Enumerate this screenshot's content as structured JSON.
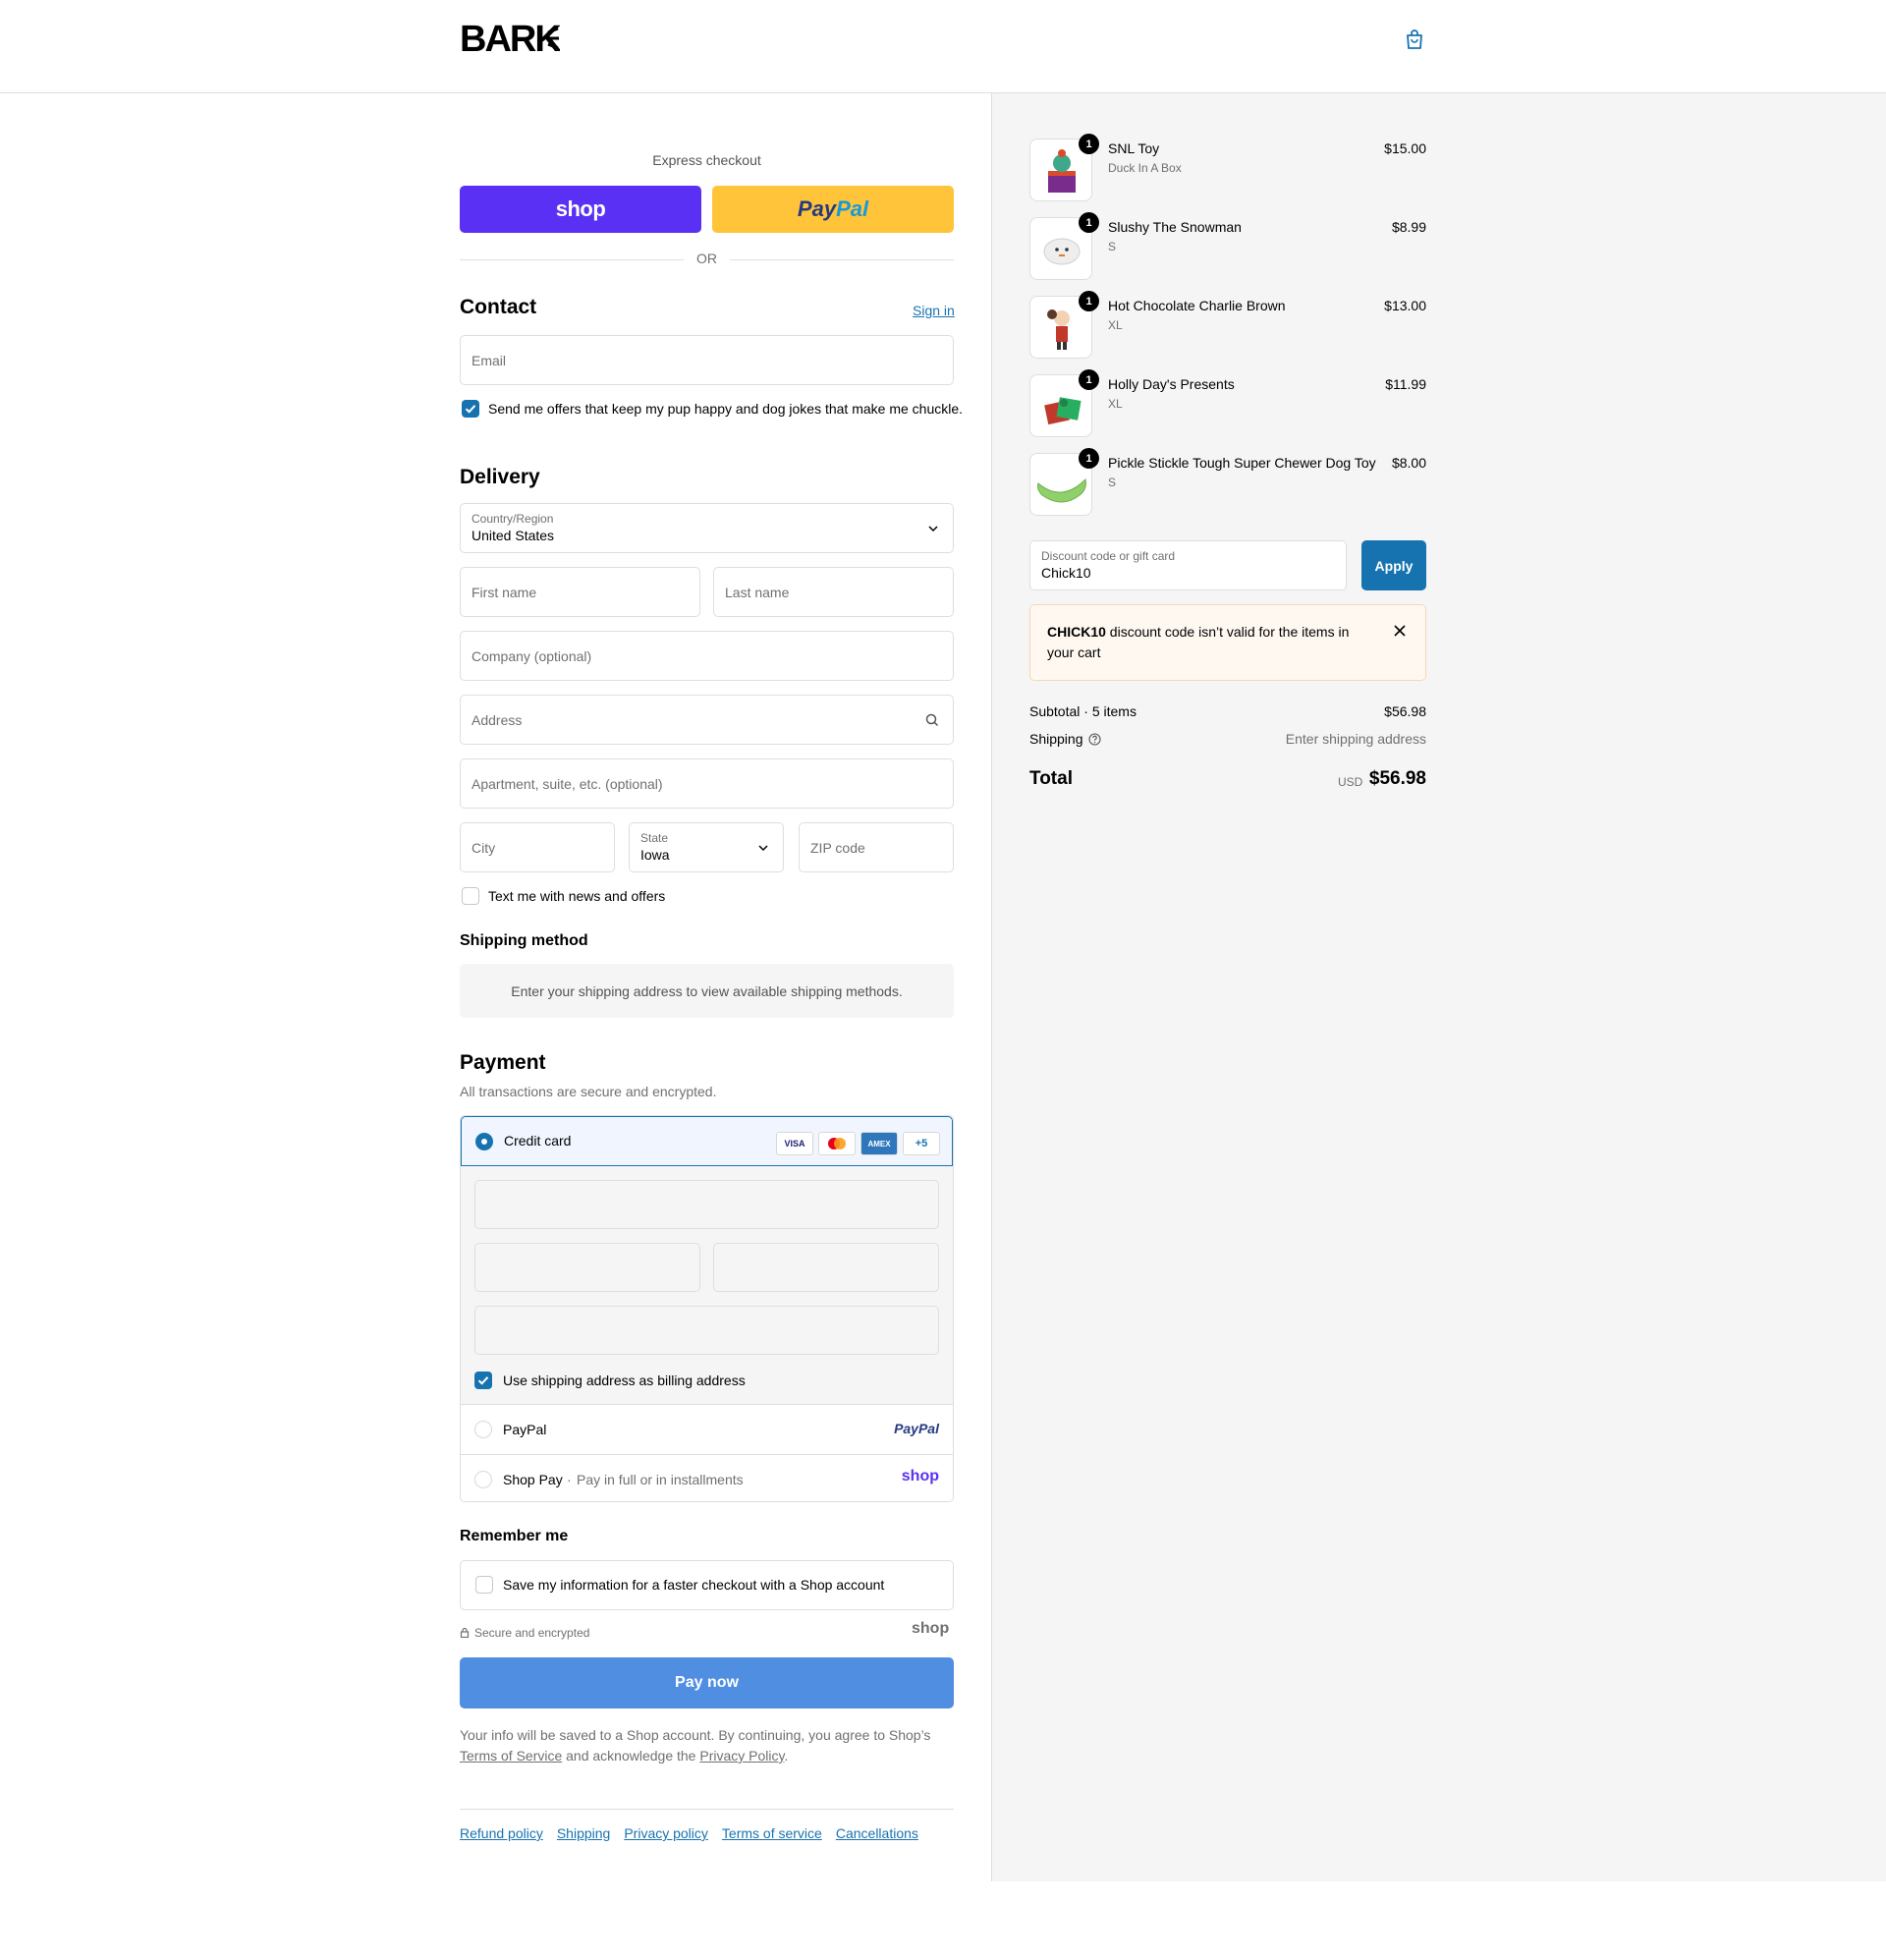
{
  "header": {
    "brand": "BARK",
    "cart_icon": "shopping-bag-icon"
  },
  "express": {
    "label": "Express checkout",
    "shop_label": "shop",
    "paypal_label_1": "Pay",
    "paypal_label_2": "Pal",
    "or": "OR"
  },
  "contact": {
    "title": "Contact",
    "sign_in": "Sign in",
    "email_placeholder": "Email",
    "offers_label": "Send me offers that keep my pup happy and dog jokes that make me chuckle.",
    "offers_checked": true
  },
  "delivery": {
    "title": "Delivery",
    "country_label": "Country/Region",
    "country_value": "United States",
    "first_name": "First name",
    "last_name": "Last name",
    "company": "Company (optional)",
    "address": "Address",
    "apartment": "Apartment, suite, etc. (optional)",
    "city": "City",
    "state_label": "State",
    "state_value": "Iowa",
    "zip": "ZIP code",
    "text_label": "Text me with news and offers",
    "text_checked": false
  },
  "shipping_method": {
    "title": "Shipping method",
    "message": "Enter your shipping address to view available shipping methods."
  },
  "payment": {
    "title": "Payment",
    "subtitle": "All transactions are secure and encrypted.",
    "credit_card": "Credit card",
    "cards": [
      "VISA",
      "MC",
      "AMEX",
      "+5"
    ],
    "billing_label": "Use shipping address as billing address",
    "paypal": "PayPal",
    "paypal_logo": "PayPal",
    "shop_pay": "Shop Pay",
    "shop_pay_sep": "·",
    "shop_pay_note": "Pay in full or in installments",
    "shop_logo": "shop"
  },
  "remember": {
    "title": "Remember me",
    "save_label": "Save my information for a faster checkout with a Shop account",
    "secure": "Secure and encrypted",
    "shop_logo": "shop"
  },
  "pay_now": "Pay now",
  "legal": {
    "line1": "Your info will be saved to a Shop account. By continuing, you agree to Shop’s",
    "tos": "Terms of Service",
    "and": " and acknowledge the ",
    "privacy": "Privacy Policy",
    "dot": "."
  },
  "footer_links": [
    "Refund policy",
    "Shipping",
    "Privacy policy",
    "Terms of service",
    "Cancellations"
  ],
  "cart": {
    "items": [
      {
        "qty": "1",
        "name": "SNL Toy",
        "variant": "Duck In A Box",
        "price": "$15.00"
      },
      {
        "qty": "1",
        "name": "Slushy The Snowman",
        "variant": "S",
        "price": "$8.99"
      },
      {
        "qty": "1",
        "name": "Hot Chocolate Charlie Brown",
        "variant": "XL",
        "price": "$13.00"
      },
      {
        "qty": "1",
        "name": "Holly Day's Presents",
        "variant": "XL",
        "price": "$11.99"
      },
      {
        "qty": "1",
        "name": "Pickle Stickle Tough Super Chewer Dog Toy",
        "variant": "S",
        "price": "$8.00"
      }
    ],
    "discount_label": "Discount code or gift card",
    "discount_value": "Chick10",
    "apply": "Apply",
    "error_code": "CHICK10",
    "error_msg": " discount code isn’t valid for the items in your cart",
    "subtotal_label": "Subtotal · 5 items",
    "subtotal": "$56.98",
    "shipping_label": "Shipping",
    "shipping_value": "Enter shipping address",
    "total_label": "Total",
    "currency": "USD",
    "total": "$56.98"
  },
  "colors": {
    "accent": "#1773b0",
    "shop_purple": "#5a31f4",
    "paypal_yellow": "#ffc439",
    "pay_now": "#4f8ee0"
  }
}
